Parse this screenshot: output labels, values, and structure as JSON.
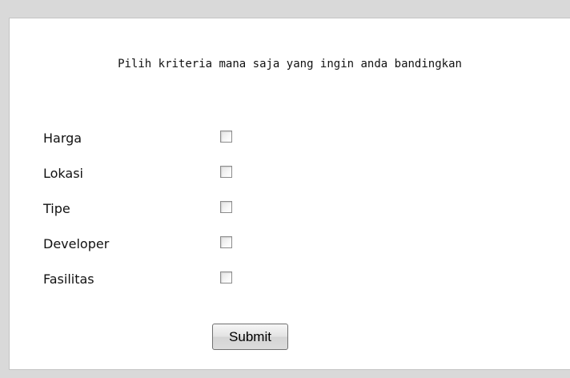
{
  "form": {
    "heading": "Pilih kriteria mana saja yang ingin anda bandingkan",
    "criteria": [
      {
        "label": "Harga",
        "checked": false
      },
      {
        "label": "Lokasi",
        "checked": false
      },
      {
        "label": "Tipe",
        "checked": false
      },
      {
        "label": "Developer",
        "checked": false
      },
      {
        "label": "Fasilitas",
        "checked": false
      }
    ],
    "submit_label": "Submit"
  }
}
